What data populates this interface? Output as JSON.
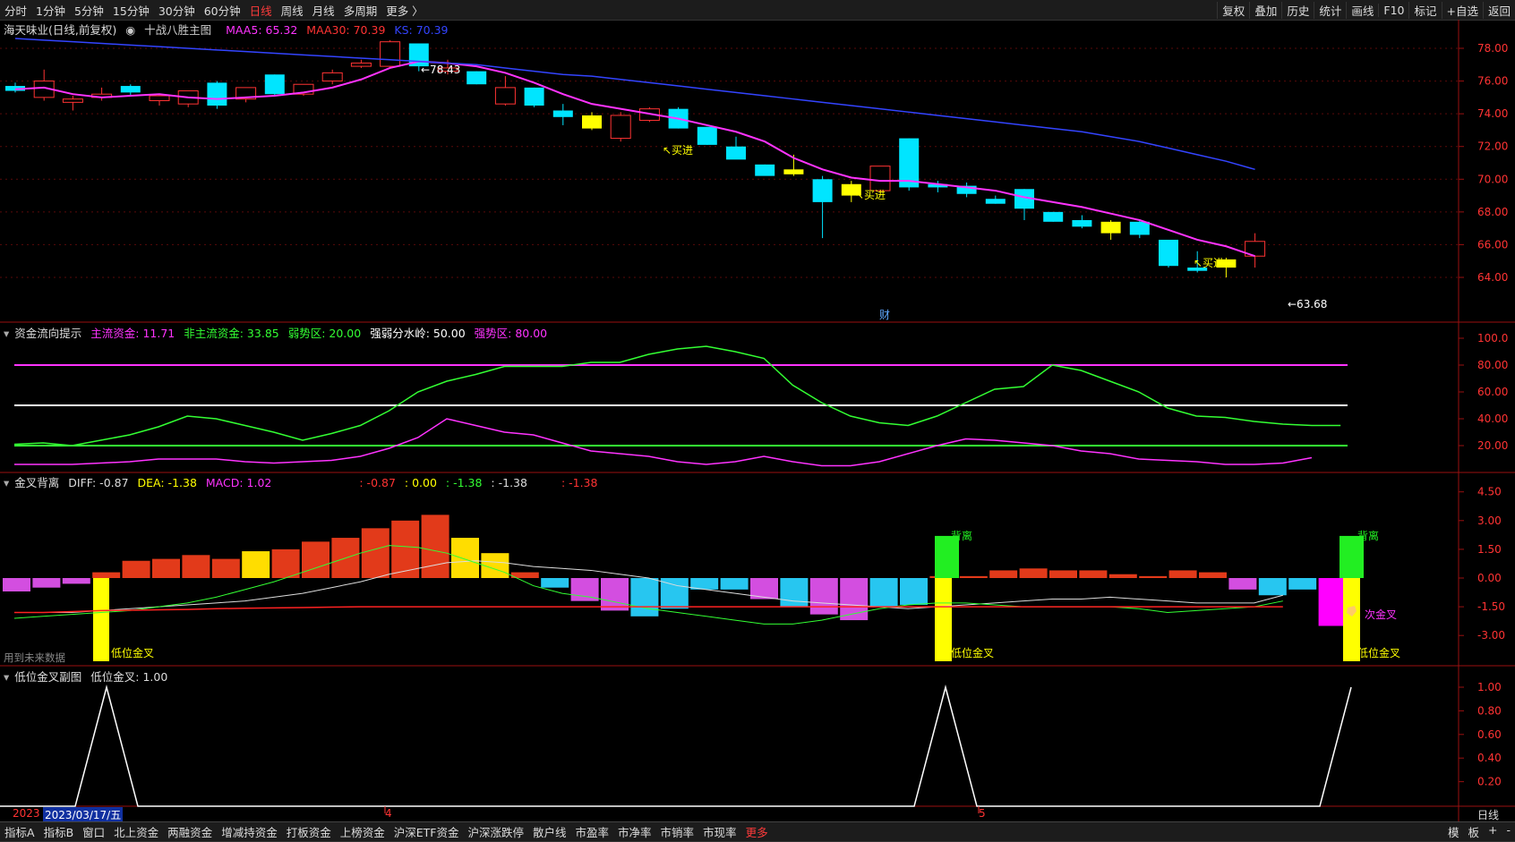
{
  "toolbar": {
    "periods": [
      "分时",
      "1分钟",
      "5分钟",
      "15分钟",
      "30分钟",
      "60分钟",
      "日线",
      "周线",
      "月线",
      "多周期",
      "更多 〉"
    ],
    "selected_period": "日线",
    "right_buttons": [
      "复权",
      "叠加",
      "历史",
      "统计",
      "画线",
      "F10",
      "标记",
      "+自选",
      "返回"
    ]
  },
  "main_pane": {
    "stock": "海天味业(日线,前复权)",
    "indicator": "十战八胜主图",
    "maa5": "MAA5: 65.32",
    "maa30": "MAA30: 70.39",
    "ks": "KS: 70.39",
    "price_ticks": [
      "78.00",
      "76.00",
      "74.00",
      "72.00",
      "70.00",
      "68.00",
      "66.00",
      "64.00"
    ],
    "high_label": "←78.43",
    "low_label": "←63.68",
    "buy_label": "买进",
    "cai_label": "财",
    "colors": {
      "maa5": "#ff33ff",
      "maa30": "#ff3333",
      "ks": "#3344ff",
      "up": "#ff3333",
      "down": "#00e5ff",
      "signal": "#ffff00"
    }
  },
  "flow_pane": {
    "title": "资金流向提示",
    "main_fund": "主流资金: 11.71",
    "non_main_fund": "非主流资金: 33.85",
    "weak": "弱势区: 20.00",
    "divide": "强弱分水岭: 50.00",
    "strong": "强势区: 80.00",
    "ticks": [
      "100.0",
      "80.00",
      "60.00",
      "40.00",
      "20.00"
    ]
  },
  "macd_pane": {
    "title": "金叉背离",
    "diff": "DIFF: -0.87",
    "dea": "DEA: -1.38",
    "macd": "MACD: 1.02",
    "extra1": ": -0.87",
    "extra2": ": 0.00",
    "extra3": ": -1.38",
    "extra4": ": -1.38",
    "extra5": ": -1.38",
    "ticks": [
      "4.50",
      "3.00",
      "1.50",
      "0.00",
      "-1.50",
      "-3.00"
    ],
    "low_golden": "低位金叉",
    "divergence": "背离",
    "second_golden": "次金叉",
    "future_note": "用到未来数据"
  },
  "sub_pane": {
    "title": "低位金叉副图",
    "value": "低位金叉: 1.00",
    "ticks": [
      "1.00",
      "0.80",
      "0.60",
      "0.40",
      "0.20"
    ]
  },
  "date_axis": {
    "year": "2023",
    "cursor_date": "2023/03/17/五",
    "month4": "4",
    "month5": "5",
    "period_label": "日线"
  },
  "bottom_tabs": [
    "指标A",
    "指标B",
    "窗口",
    "北上资金",
    "两融资金",
    "增减持资金",
    "打板资金",
    "上榜资金",
    "沪深ETF资金",
    "沪深涨跌停",
    "散户线",
    "市盈率",
    "市净率",
    "市销率",
    "市现率",
    "更多"
  ],
  "bottom_right": [
    "模",
    "板",
    "+",
    "-"
  ]
}
